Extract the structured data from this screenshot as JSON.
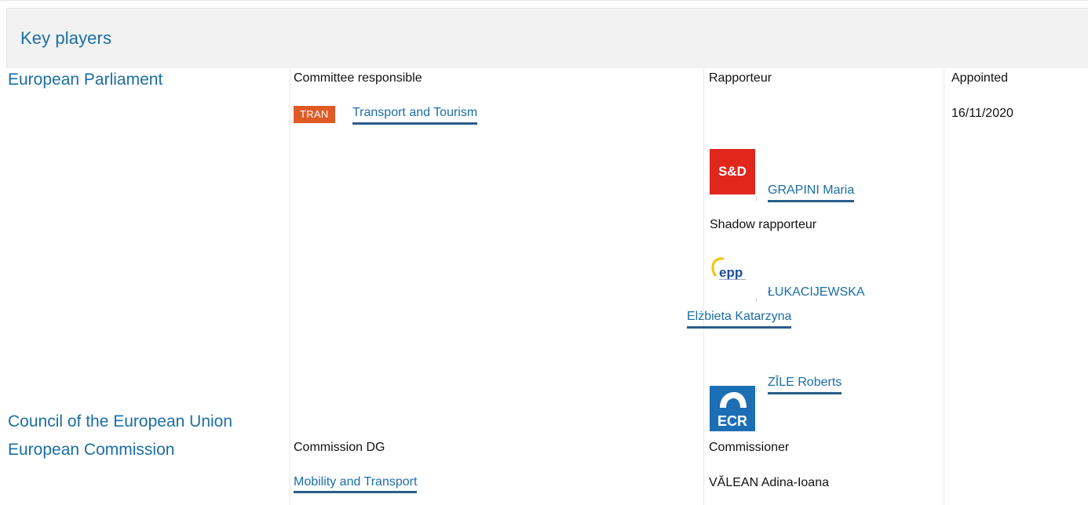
{
  "section": {
    "title": "Key players"
  },
  "ep": {
    "institution": "European Parliament",
    "col_committee": "Committee responsible",
    "col_rapporteur": "Rapporteur",
    "col_appointed": "Appointed",
    "committee_tag": "TRAN",
    "committee_name": "Transport and Tourism",
    "appointed_date": "16/11/2020",
    "rapporteur": {
      "group_logo": "S&D",
      "name": "GRAPINI Maria"
    },
    "shadow_label": "Shadow rapporteur",
    "shadows": [
      {
        "group_logo": "epp",
        "name_line1": "ŁUKACIJEWSKA",
        "name_line2": "Elżbieta Katarzyna"
      },
      {
        "group_logo": "ECR",
        "name": "ZĪLE Roberts"
      }
    ]
  },
  "council": {
    "institution": "Council of the European Union"
  },
  "commission": {
    "institution": "European Commission",
    "col_dg": "Commission DG",
    "col_commissioner": "Commissioner",
    "dg_name": "Mobility and Transport",
    "commissioner_name": "VĂLEAN Adina-Ioana"
  },
  "colors": {
    "link": "#1a6ea6",
    "tag_bg": "#e05a25",
    "sd_red": "#e1261c",
    "ecr_blue": "#1c6fb5",
    "header_bg": "#f2f2f2"
  }
}
